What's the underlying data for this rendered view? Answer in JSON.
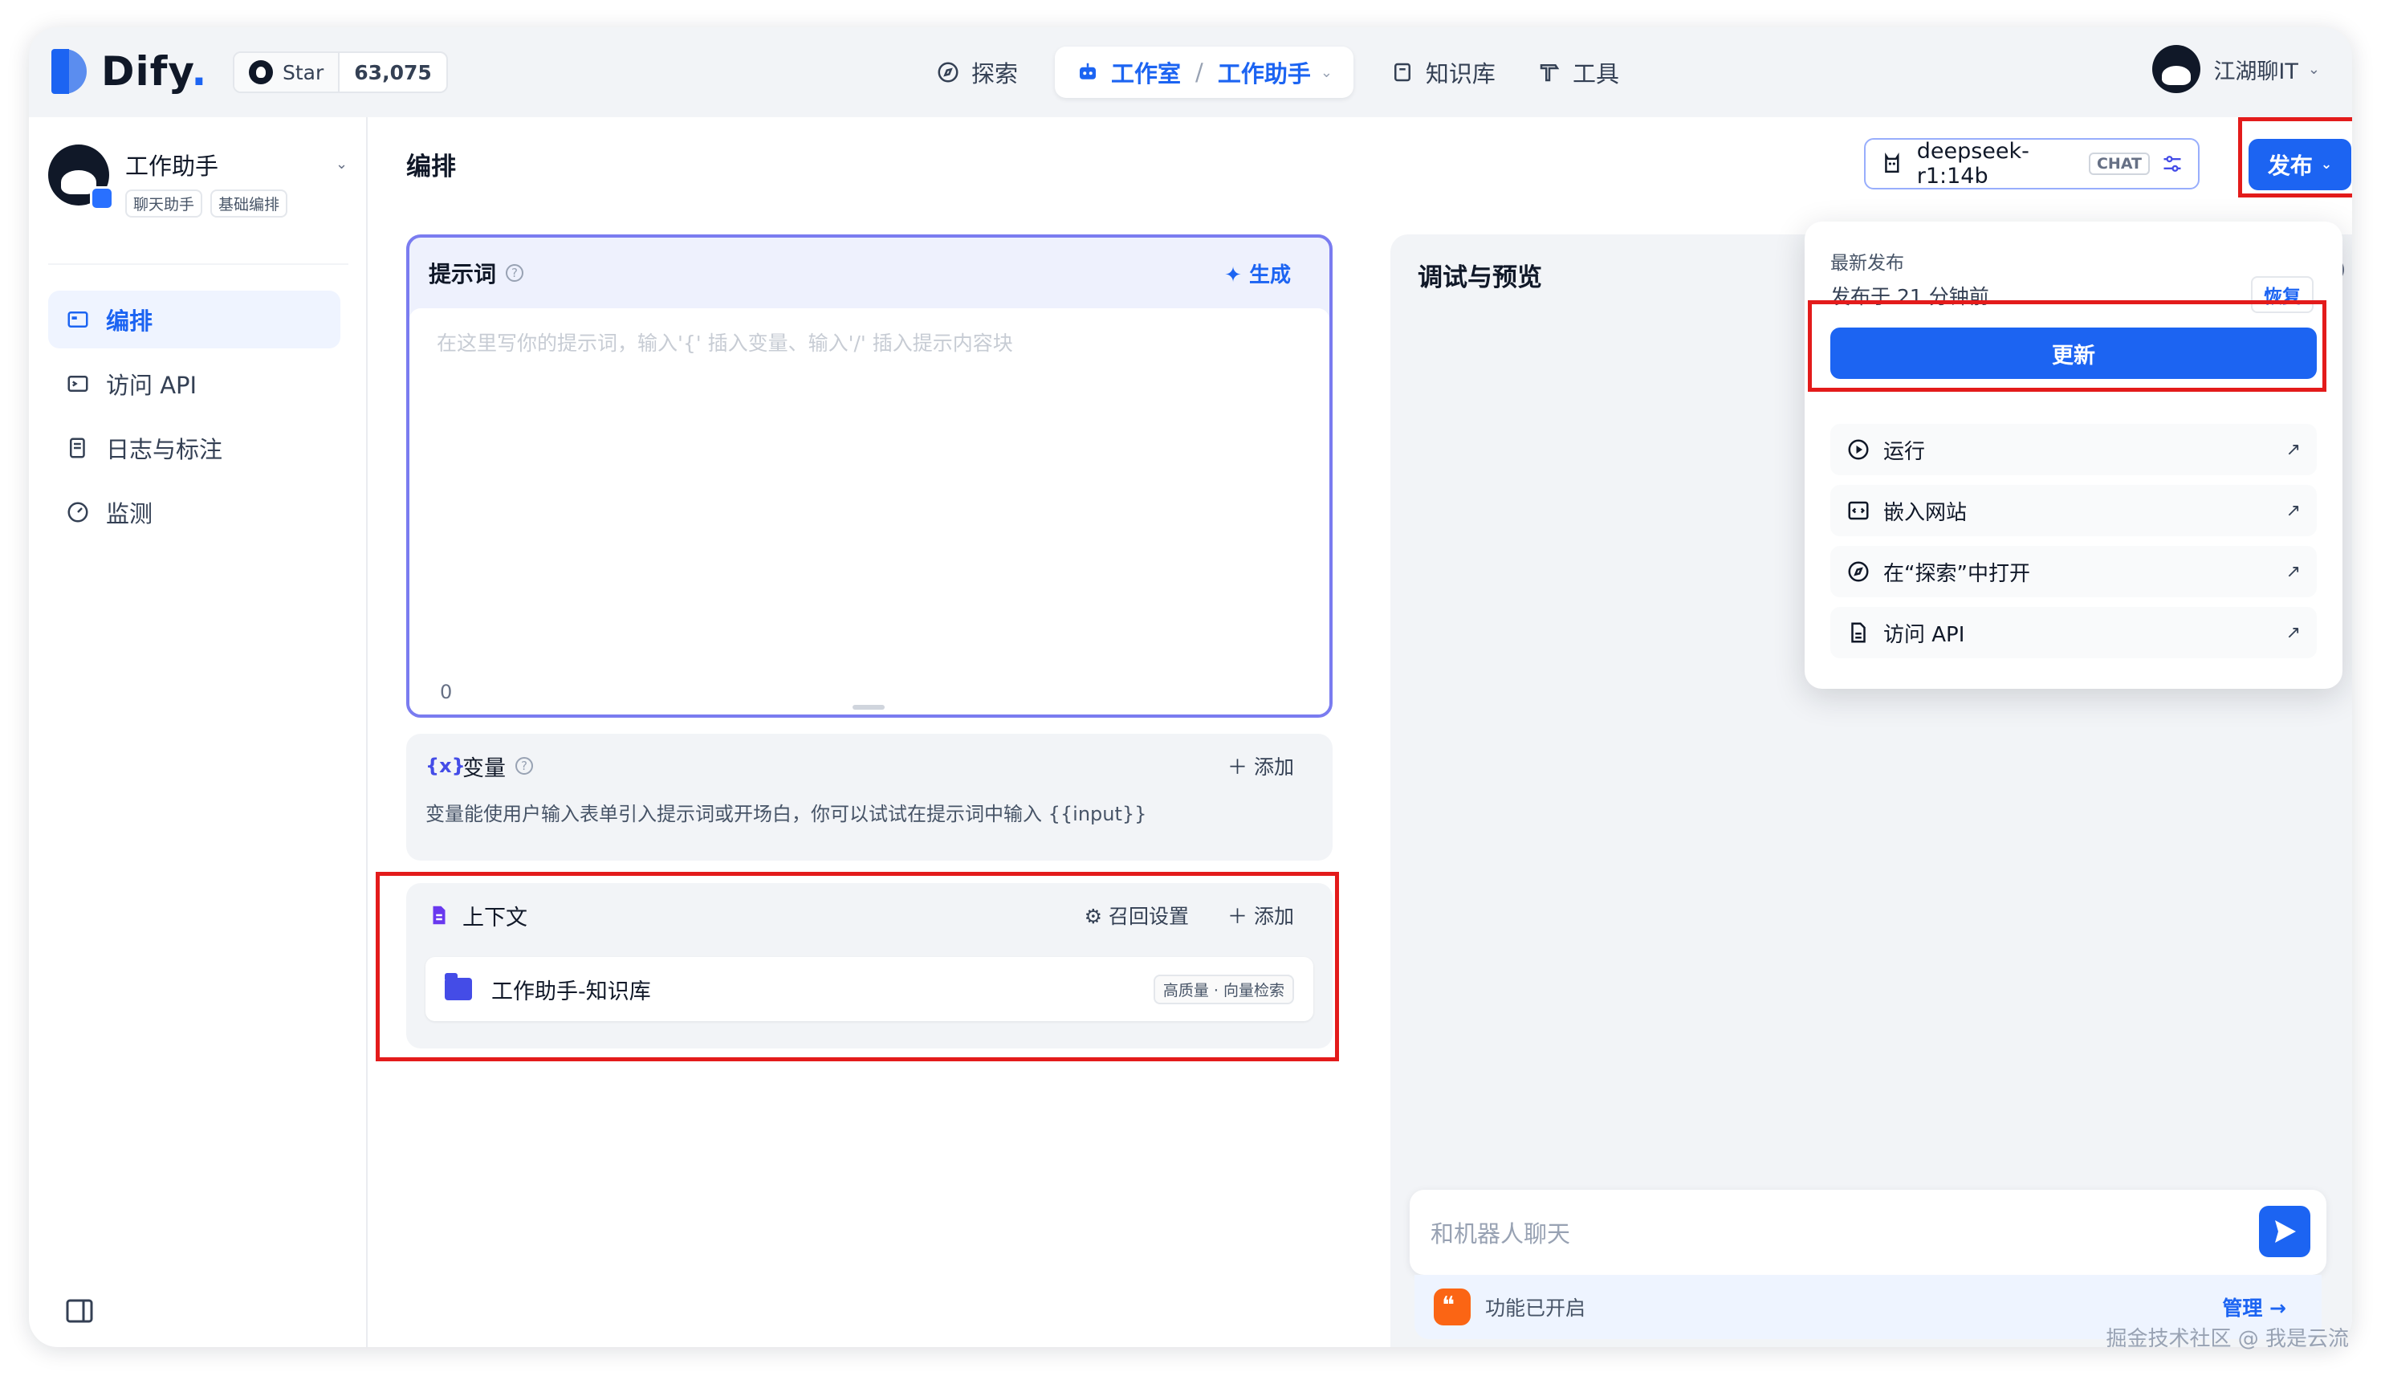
{
  "brand": {
    "name": "Dify",
    "name_suffix": "."
  },
  "github": {
    "star_label": "Star",
    "star_count": "63,075"
  },
  "nav": {
    "explore": "探索",
    "studio": "工作室",
    "studio_app": "工作助手",
    "knowledge": "知识库",
    "tools": "工具"
  },
  "user": {
    "name": "江湖聊IT"
  },
  "app": {
    "name": "工作助手",
    "tags": [
      "聊天助手",
      "基础编排"
    ]
  },
  "sidebar": {
    "items": [
      {
        "label": "编排",
        "active": true
      },
      {
        "label": "访问 API"
      },
      {
        "label": "日志与标注"
      },
      {
        "label": "监测"
      }
    ]
  },
  "main": {
    "title": "编排",
    "model": {
      "name": "deepseek-r1:14b",
      "badge": "CHAT"
    },
    "publish_label": "发布"
  },
  "prompt": {
    "label": "提示词",
    "generate": "生成",
    "placeholder": "在这里写你的提示词，输入'{' 插入变量、输入'/' 插入提示内容块",
    "char_count": "0"
  },
  "variables": {
    "label": "变量",
    "add": "添加",
    "description": "变量能使用户输入表单引入提示词或开场白，你可以试试在提示词中输入 {{input}}"
  },
  "context": {
    "label": "上下文",
    "recall_settings": "召回设置",
    "add": "添加",
    "kb_name": "工作助手-知识库",
    "kb_badge": "高质量 · 向量检索"
  },
  "preview": {
    "title": "调试与预览",
    "right_glyph": ")",
    "chat_placeholder": "和机器人聊天",
    "feature_text": "功能已开启",
    "manage": "管理"
  },
  "publish_menu": {
    "latest_label": "最新发布",
    "published_time": "发布于 21 分钟前",
    "restore": "恢复",
    "update": "更新",
    "items": [
      {
        "label": "运行"
      },
      {
        "label": "嵌入网站"
      },
      {
        "label": "在“探索”中打开"
      },
      {
        "label": "访问 API"
      }
    ]
  },
  "watermark": "掘金技术社区 @ 我是云流",
  "colors": {
    "accent": "#1c64f2",
    "highlight": "#e31b1b",
    "prompt_border": "#7a7cf0"
  }
}
